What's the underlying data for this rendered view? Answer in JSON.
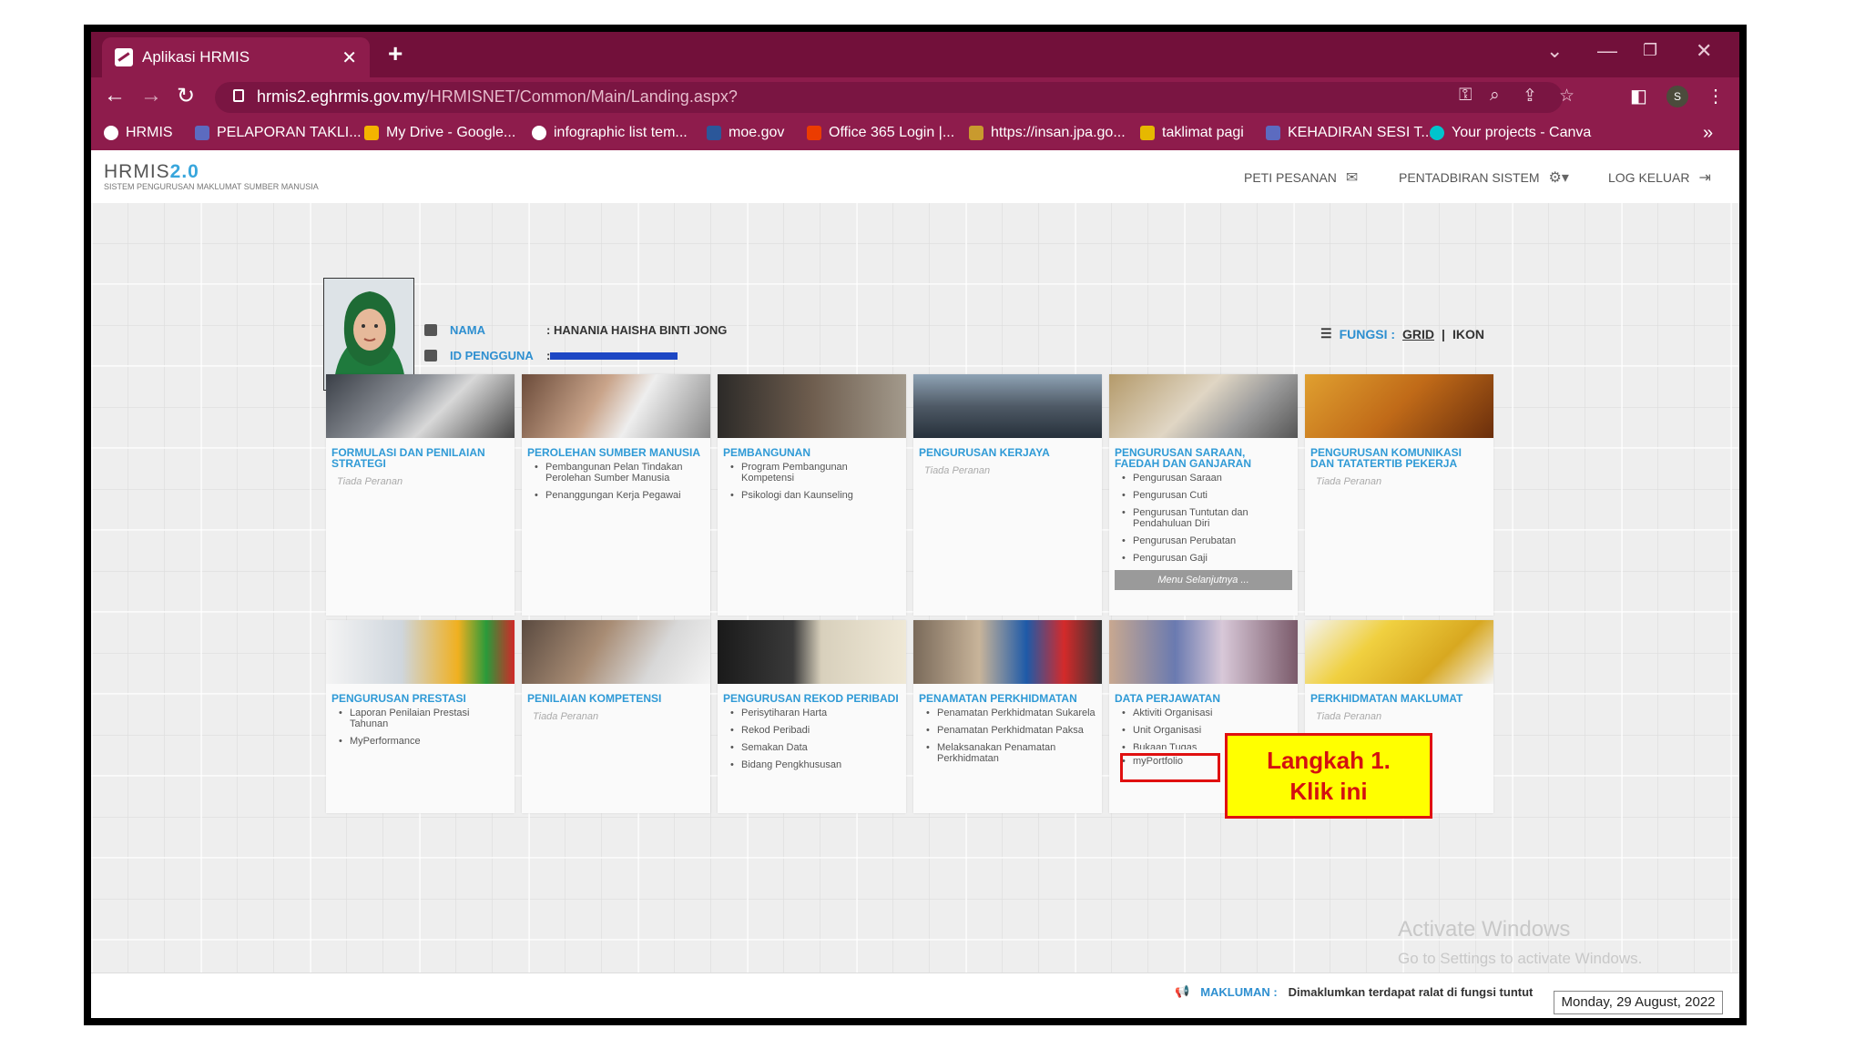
{
  "browser": {
    "tab_title": "Aplikasi HRMIS",
    "url_domain": "hrmis2.eghrmis.gov.my",
    "url_path": "/HRMISNET/Common/Main/Landing.aspx?",
    "profile_initial": "S",
    "bookmarks": [
      {
        "label": "HRMIS",
        "color": "#ffffff"
      },
      {
        "label": "PELAPORAN TAKLI...",
        "color": "#5c6bc0"
      },
      {
        "label": "My Drive - Google...",
        "color": "#f4b400"
      },
      {
        "label": "infographic list tem...",
        "color": "#ffffff"
      },
      {
        "label": "moe.gov",
        "color": "#2b579a"
      },
      {
        "label": "Office 365 Login |...",
        "color": "#eb3c00"
      },
      {
        "label": "https://insan.jpa.go...",
        "color": "#c99a2e"
      },
      {
        "label": "taklimat pagi",
        "color": "#e6b800"
      },
      {
        "label": "KEHADIRAN SESI T...",
        "color": "#5c6bc0"
      },
      {
        "label": "Your projects - Canva",
        "color": "#00c4cc"
      }
    ]
  },
  "app": {
    "logo_main": "HRMIS",
    "logo_version": "2.0",
    "logo_sub": "SISTEM PENGURUSAN MAKLUMAT SUMBER MANUSIA",
    "header_links": {
      "messages": "PETI PESANAN",
      "admin": "PENTADBIRAN SISTEM",
      "logout": "LOG KELUAR"
    }
  },
  "profile": {
    "name_label": "NAMA",
    "name_value": ": HANANIA HAISHA BINTI JONG",
    "id_label": "ID PENGGUNA",
    "id_prefix": ":",
    "fungsi_label": "FUNGSI :",
    "grid": "GRID",
    "sep": "|",
    "ikon": "IKON"
  },
  "tiles_row1": [
    {
      "title": "FORMULASI DAN PENILAIAN STRATEGI",
      "empty": "Tiada Peranan",
      "items": []
    },
    {
      "title": "PEROLEHAN SUMBER MANUSIA",
      "empty": "",
      "items": [
        "Pembangunan Pelan Tindakan Perolehan Sumber Manusia",
        "Penanggungan Kerja Pegawai"
      ]
    },
    {
      "title": "PEMBANGUNAN",
      "empty": "",
      "items": [
        "Program Pembangunan Kompetensi",
        "Psikologi dan Kaunseling"
      ]
    },
    {
      "title": "PENGURUSAN KERJAYA",
      "empty": "Tiada Peranan",
      "items": []
    },
    {
      "title": "PENGURUSAN SARAAN, FAEDAH DAN GANJARAN",
      "empty": "",
      "items": [
        "Pengurusan Saraan",
        "Pengurusan Cuti",
        "Pengurusan Tuntutan dan Pendahuluan Diri",
        "Pengurusan Perubatan",
        "Pengurusan Gaji"
      ],
      "more": "Menu Selanjutnya ..."
    },
    {
      "title": "PENGURUSAN KOMUNIKASI DAN TATATERTIB PEKERJA",
      "empty": "Tiada Peranan",
      "items": []
    }
  ],
  "tiles_row2": [
    {
      "title": "PENGURUSAN PRESTASI",
      "empty": "",
      "items": [
        "Laporan Penilaian Prestasi Tahunan",
        "MyPerformance"
      ]
    },
    {
      "title": "PENILAIAN KOMPETENSI",
      "empty": "Tiada Peranan",
      "items": []
    },
    {
      "title": "PENGURUSAN REKOD PERIBADI",
      "empty": "",
      "items": [
        "Perisytiharan Harta",
        "Rekod Peribadi",
        "Semakan Data",
        "Bidang Pengkhususan"
      ]
    },
    {
      "title": "PENAMATAN PERKHIDMATAN",
      "empty": "",
      "items": [
        "Penamatan Perkhidmatan Sukarela",
        "Penamatan Perkhidmatan Paksa",
        "Melaksanakan Penamatan Perkhidmatan"
      ]
    },
    {
      "title": "DATA PERJAWATAN",
      "empty": "",
      "items": [
        "Aktiviti Organisasi",
        "Unit Organisasi",
        "Bukaan Tugas",
        "myPortfolio"
      ]
    },
    {
      "title": "PERKHIDMATAN MAKLUMAT",
      "empty": "Tiada Peranan",
      "items": []
    }
  ],
  "annotation": {
    "line1": "Langkah 1.",
    "line2": "Klik ini"
  },
  "watermark": {
    "line1": "Activate Windows",
    "line2": "Go to Settings to activate Windows."
  },
  "footer": {
    "label": "MAKLUMAN :",
    "text": "Dimaklumkan terdapat ralat di fungsi tuntut",
    "date": "Monday, 29 August, 2022"
  },
  "colors": {
    "browser_frame": "#72103a",
    "browser_toolbar": "#8e1c4c",
    "tile_title": "#2f9ad6",
    "annotation_fill": "#ffff00",
    "annotation_border": "#e01010"
  }
}
